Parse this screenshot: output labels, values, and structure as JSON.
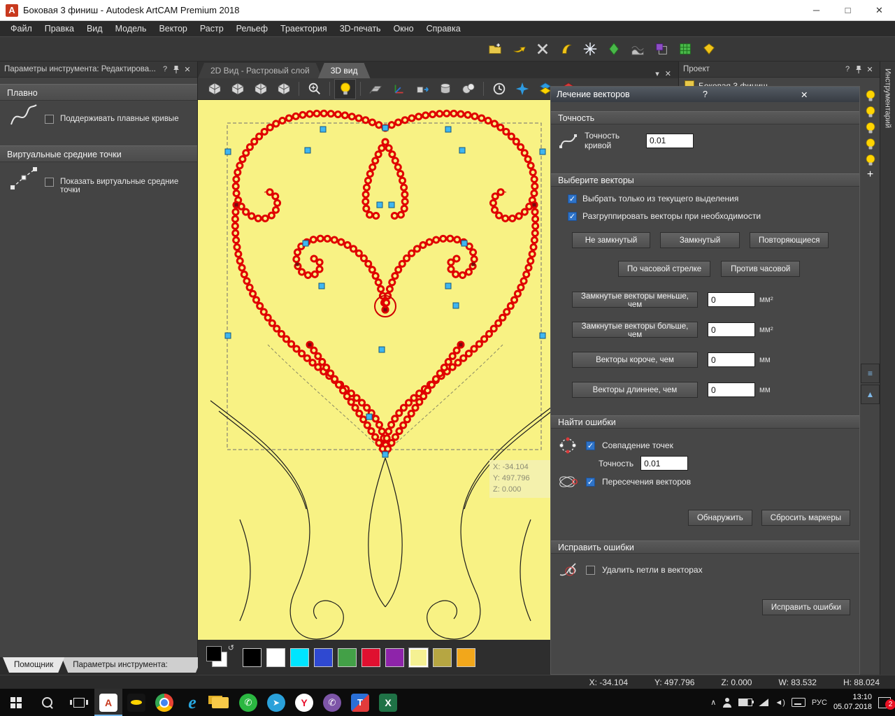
{
  "titlebar": {
    "app_glyph": "A",
    "title": "Боковая 3 финиш - Autodesk ArtCAM Premium 2018",
    "controls": {
      "minimize": "─",
      "maximize": "□",
      "close": "✕"
    }
  },
  "menubar": {
    "items": [
      "Файл",
      "Правка",
      "Вид",
      "Модель",
      "Вектор",
      "Растр",
      "Рельеф",
      "Траектория",
      "3D-печать",
      "Окно",
      "Справка"
    ]
  },
  "top_toolbar": {
    "icons": [
      "folder-new",
      "export-arrow",
      "tool-cross",
      "curve-hook",
      "snowflake",
      "gem-green",
      "relief-stack",
      "block-purple",
      "mesh-green",
      "gem-yellow"
    ]
  },
  "view_toolbar": {
    "icons": [
      "cube-iso",
      "cube-front",
      "cube-side",
      "cube-top",
      "divider",
      "zoom",
      "divider",
      "bulb",
      "divider",
      "plane",
      "axes",
      "move",
      "cylinder",
      "spheres",
      "divider",
      "clock",
      "star",
      "layers-blue",
      "layers-red"
    ]
  },
  "tool_panel": {
    "title": "Параметры инструмента: Редактирова...",
    "help_glyph": "?",
    "close_glyph": "✕",
    "smooth_section": {
      "title": "Плавно",
      "option": "Поддерживать плавные кривые",
      "checked": false
    },
    "midpoint_section": {
      "title": "Виртуальные средние точки",
      "option": "Показать виртуальные средние точки",
      "checked": false
    }
  },
  "view_tabs": {
    "tab_2d": "2D Вид - Растровый слой",
    "tab_3d": "3D вид",
    "chevron_glyph": "▾",
    "close_glyph": "✕"
  },
  "canvas": {
    "tooltip": {
      "x": "X: -34.104",
      "y": "Y: 497.796",
      "z": "Z: 0.000"
    }
  },
  "project_panel": {
    "title": "Проект",
    "help_glyph": "?",
    "close_glyph": "✕",
    "item": "Боковая 3 финиш"
  },
  "vector_doctor": {
    "title": "Лечение векторов",
    "help_glyph": "?",
    "close_glyph": "✕",
    "tolerance": {
      "section": "Точность",
      "label": "Точность кривой",
      "value": "0.01"
    },
    "select": {
      "section": "Выберите векторы",
      "cb_selection": {
        "label": "Выбрать только из текущего выделения",
        "checked": true
      },
      "cb_ungroup": {
        "label": "Разгруппировать векторы при необходимости",
        "checked": true
      },
      "btn_open": "Не замкнутый",
      "btn_closed": "Замкнутый",
      "btn_duplicate": "Повторяющиеся",
      "btn_cw": "По часовой стрелке",
      "btn_ccw": "Против часовой",
      "filters": [
        {
          "label": "Замкнутые векторы меньше, чем",
          "value": "0",
          "unit": "мм²"
        },
        {
          "label": "Замкнутые векторы больше, чем",
          "value": "0",
          "unit": "мм²"
        },
        {
          "label": "Векторы короче, чем",
          "value": "0",
          "unit": "мм"
        },
        {
          "label": "Векторы длиннее, чем",
          "value": "0",
          "unit": "мм"
        }
      ]
    },
    "find": {
      "section": "Найти ошибки",
      "cb_coincident": {
        "label": "Совпадение точек",
        "checked": true
      },
      "tolerance_label": "Точность",
      "tolerance_value": "0.01",
      "cb_intersections": {
        "label": "Пересечения векторов",
        "checked": true
      },
      "btn_detect": "Обнаружить",
      "btn_reset": "Сбросить маркеры"
    },
    "fix": {
      "section": "Исправить ошибки",
      "cb_loops": {
        "label": "Удалить петли в векторах",
        "checked": false
      },
      "btn_fix": "Исправить ошибки"
    }
  },
  "right_strip": {
    "label": "Инструментарий",
    "bulb_count": 5,
    "add_label": "+"
  },
  "bottom_tabs": {
    "tabs": [
      "Помощник",
      "Параметры инструмента: Реда..."
    ]
  },
  "palette": {
    "primary": "#000000",
    "secondary": "#ffffff",
    "colors": [
      "#000000",
      "#ffffff",
      "#00e5ff",
      "#2f49d1",
      "#43a047",
      "#e01030",
      "#8e24aa",
      "#f5f193",
      "#b6a642",
      "#f2a71b"
    ],
    "selected_index": 7,
    "swap_glyph": "↺"
  },
  "status_bar": {
    "fields": [
      "X: -34.104",
      "Y: 497.796",
      "Z: 0.000",
      "W: 83.532",
      "H: 88.024"
    ]
  },
  "taskbar": {
    "apps": [
      {
        "name": "artcam",
        "glyph": "A",
        "active": true
      },
      {
        "name": "batman",
        "glyph": ""
      },
      {
        "name": "chrome",
        "glyph": ""
      },
      {
        "name": "edge",
        "glyph": "e"
      },
      {
        "name": "explorer",
        "glyph": ""
      },
      {
        "name": "whatsapp",
        "glyph": "✆"
      },
      {
        "name": "telegram",
        "glyph": "➤"
      },
      {
        "name": "yandex",
        "glyph": "Y"
      },
      {
        "name": "viber",
        "glyph": "✆"
      },
      {
        "name": "translator",
        "glyph": "T"
      },
      {
        "name": "excel",
        "glyph": "X"
      }
    ],
    "lang": "РУС",
    "time": "13:10",
    "date": "05.07.2018",
    "badge": "2"
  }
}
